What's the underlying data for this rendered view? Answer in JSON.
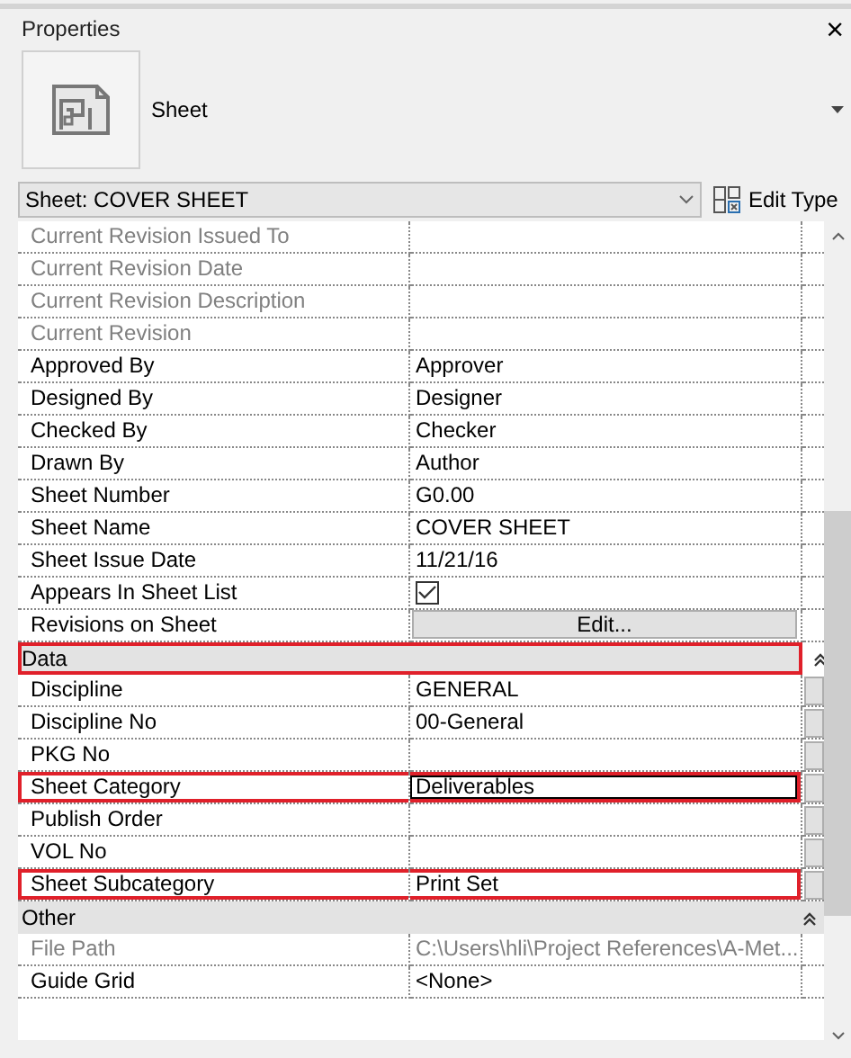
{
  "panel": {
    "title": "Properties",
    "close": "×"
  },
  "type_selector": {
    "label": "Sheet"
  },
  "instance": {
    "value": "Sheet: COVER SHEET",
    "edit_type": "Edit Type"
  },
  "sections": [
    {
      "rows": [
        {
          "label": "Current Revision Issued To",
          "kind": "text",
          "disabled": true,
          "highlighted": false
        },
        {
          "label": "Current Revision Date",
          "kind": "text",
          "disabled": true,
          "highlighted": false
        },
        {
          "label": "Current Revision Description",
          "kind": "text",
          "disabled": true,
          "highlighted": false
        },
        {
          "label": "Current Revision",
          "kind": "text",
          "disabled": true,
          "highlighted": false
        },
        {
          "label": "Approved By",
          "kind": "text",
          "value": "Approver",
          "disabled": false,
          "highlighted": false
        },
        {
          "label": "Designed By",
          "kind": "text",
          "value": "Designer",
          "disabled": false,
          "highlighted": false
        },
        {
          "label": "Checked By",
          "kind": "text",
          "value": "Checker",
          "disabled": false,
          "highlighted": false
        },
        {
          "label": "Drawn By",
          "kind": "text",
          "value": "Author",
          "disabled": false,
          "highlighted": false
        },
        {
          "label": "Sheet Number",
          "kind": "text",
          "value": "G0.00",
          "disabled": false,
          "highlighted": false
        },
        {
          "label": "Sheet Name",
          "kind": "text",
          "value": "COVER SHEET",
          "disabled": false,
          "highlighted": false
        },
        {
          "label": "Sheet Issue Date",
          "kind": "text",
          "value": "11/21/16",
          "disabled": false,
          "highlighted": false
        },
        {
          "label": "Appears In Sheet List",
          "kind": "checkbox",
          "checked": true,
          "disabled": false,
          "highlighted": false
        },
        {
          "label": "Revisions on Sheet",
          "kind": "button",
          "value": "Edit...",
          "disabled": false,
          "highlighted": false
        }
      ]
    },
    {
      "title": "Data",
      "expanded": true,
      "highlighted": true,
      "rows": [
        {
          "label": "Discipline",
          "kind": "text",
          "value": "GENERAL",
          "disabled": false,
          "highlighted": false,
          "side_button": true
        },
        {
          "label": "Discipline No",
          "kind": "text",
          "value": "00-General",
          "disabled": false,
          "highlighted": false,
          "side_button": true
        },
        {
          "label": "PKG No",
          "kind": "text",
          "disabled": false,
          "highlighted": false,
          "side_button": true
        },
        {
          "label": "Sheet Category",
          "kind": "text",
          "value": "Deliverables",
          "disabled": false,
          "highlighted": true,
          "editing": true,
          "side_button": true
        },
        {
          "label": "Publish Order",
          "kind": "text",
          "disabled": false,
          "highlighted": false,
          "side_button": true
        },
        {
          "label": "VOL No",
          "kind": "text",
          "disabled": false,
          "highlighted": false,
          "side_button": true
        },
        {
          "label": "Sheet Subcategory",
          "kind": "text",
          "value": "Print Set",
          "disabled": false,
          "highlighted": true,
          "side_button": true
        }
      ]
    },
    {
      "title": "Other",
      "expanded": true,
      "highlighted": false,
      "rows": [
        {
          "label": "File Path",
          "kind": "text",
          "value": "C:\\Users\\hli\\Project References\\A-Met...",
          "disabled": true,
          "highlighted": false
        },
        {
          "label": "Guide Grid",
          "kind": "text",
          "value": "<None>",
          "disabled": false,
          "highlighted": false
        }
      ]
    }
  ]
}
